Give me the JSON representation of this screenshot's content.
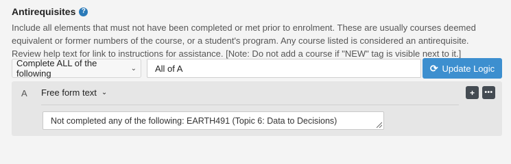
{
  "section": {
    "title": "Antirequisites",
    "help_icon": "?",
    "description_lines": [
      "Include all elements that must not have been completed or met prior to enrolment. These are usually courses deemed",
      "equivalent or former numbers of the course, or a student's program. Any course listed is considered an antirequisite.",
      "Review help text for link to instructions for assistance. [Note: Do not add a course if \"NEW\" tag is visible next to it.]"
    ]
  },
  "controls": {
    "logic_select": "Complete ALL of the following",
    "logic_input": "All of A",
    "update_button": "Update Logic"
  },
  "rule": {
    "letter": "A",
    "type_select": "Free form text",
    "plus_label": "+",
    "more_label": "•••",
    "text_value": "Not completed any of the following: EARTH491 (Topic 6: Data to Decisions)"
  },
  "colors": {
    "accent": "#3d8fcf",
    "help_icon": "#2a7ab8",
    "icon_button": "#444b52",
    "panel_bg": "#e6e6e6"
  },
  "icons": [
    "help-icon",
    "chevron-down-icon",
    "refresh-icon",
    "plus-icon",
    "more-icon",
    "resize-grip-icon"
  ]
}
